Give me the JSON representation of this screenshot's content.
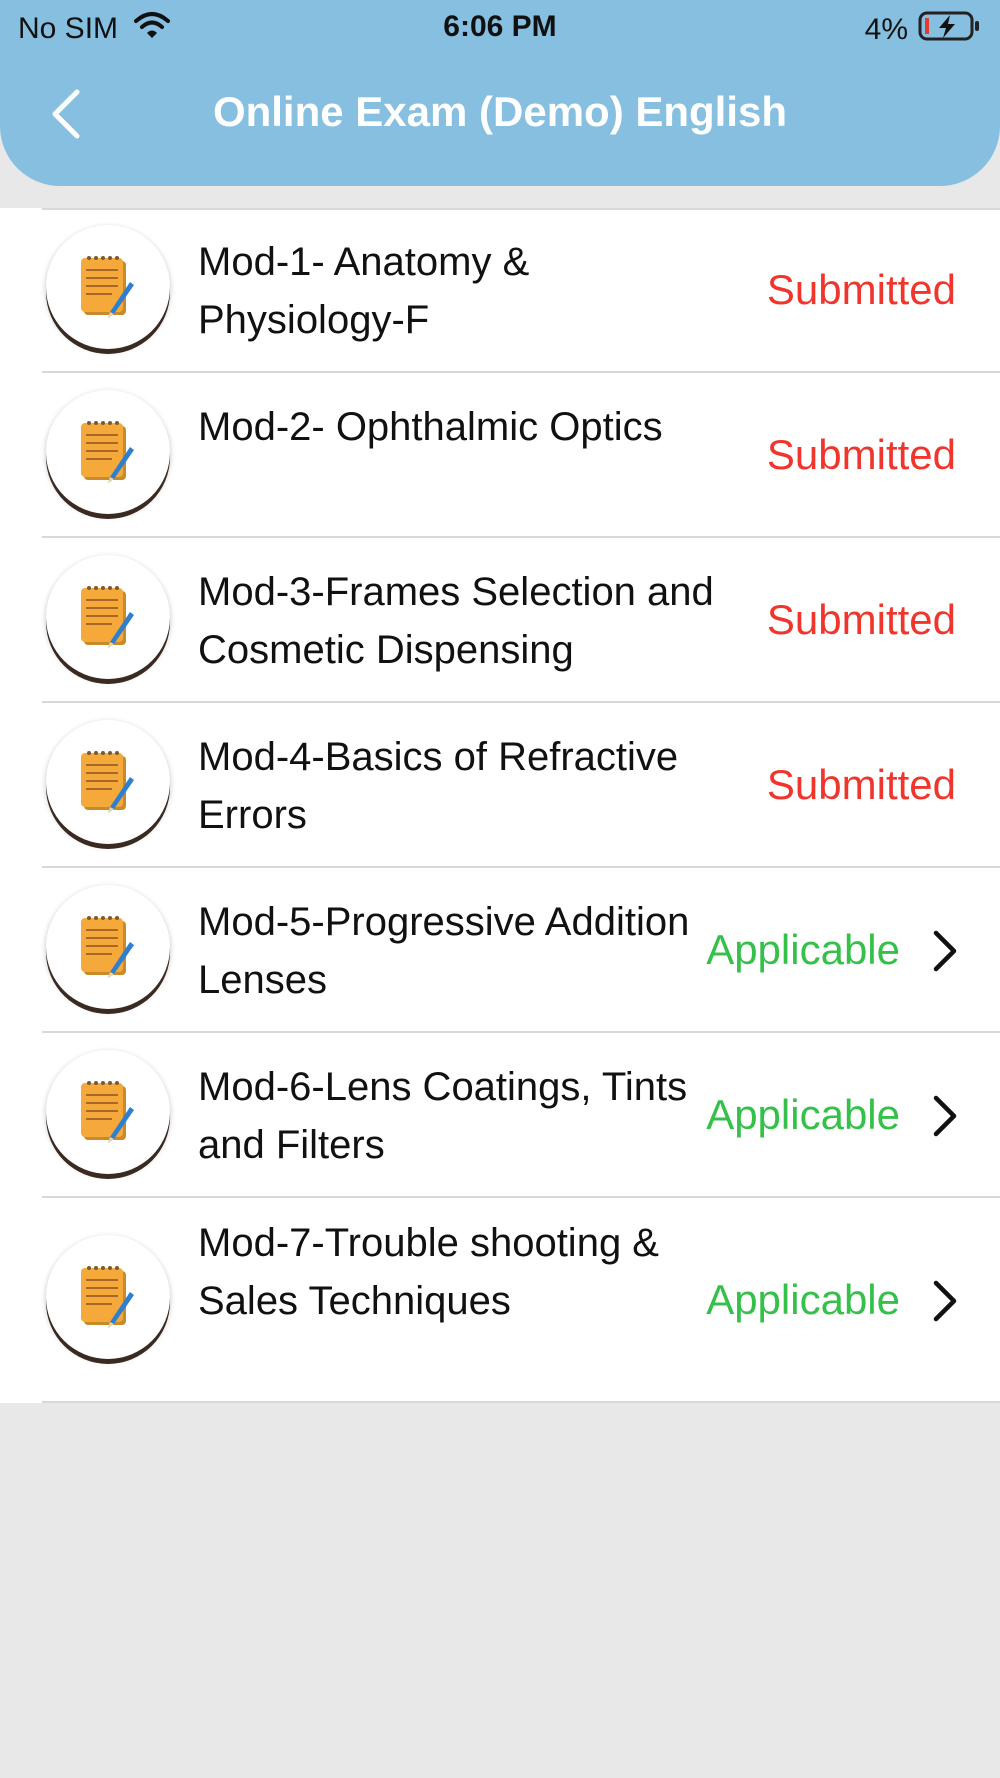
{
  "status_bar": {
    "carrier": "No SIM",
    "time": "6:06 PM",
    "battery": "4%"
  },
  "nav": {
    "title": "Online Exam (Demo) English"
  },
  "colors": {
    "header": "#86bfe0",
    "submitted": "#f0352d",
    "applicable": "#35c04a"
  },
  "exams": [
    {
      "title": "Mod-1- Anatomy & Physiology-F",
      "status": "Submitted"
    },
    {
      "title": "Mod-2- Ophthalmic Optics",
      "status": "Submitted"
    },
    {
      "title": "Mod-3-Frames Selection and Cosmetic Dispensing",
      "status": "Submitted"
    },
    {
      "title": "Mod-4-Basics of Refractive Errors",
      "status": "Submitted"
    },
    {
      "title": "Mod-5-Progressive Addition Lenses",
      "status": "Applicable"
    },
    {
      "title": "Mod-6-Lens Coatings, Tints and Filters",
      "status": "Applicable"
    },
    {
      "title": "Mod-7-Trouble shooting & Sales Techniques",
      "status": "Applicable"
    }
  ]
}
